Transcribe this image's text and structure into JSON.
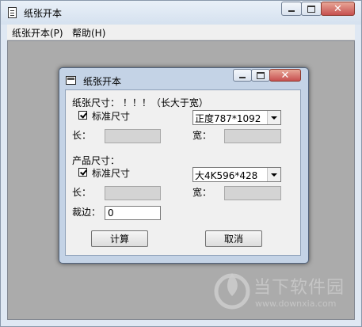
{
  "window": {
    "title": "纸张开本",
    "controls": {
      "minimize": "minimize",
      "maximize": "maximize",
      "close": "✕"
    }
  },
  "menu": [
    {
      "label": "纸张开本(P)"
    },
    {
      "label": "帮助(H)"
    }
  ],
  "dialog": {
    "title": "纸张开本",
    "paper": {
      "heading": "纸张尺寸：  ！！！（长大于宽）",
      "standard_label": "标准尺寸",
      "standard_checked": true,
      "size_select": "正度787*1092",
      "length_label": "长：",
      "width_label": "宽：",
      "length_value": "",
      "width_value": ""
    },
    "product": {
      "heading": "产品尺寸：",
      "standard_label": "标准尺寸",
      "standard_checked": true,
      "size_select": "大4K596*428",
      "length_label": "长：",
      "width_label": "宽：",
      "length_value": "",
      "width_value": ""
    },
    "trim_label": "裁边：",
    "trim_value": "0",
    "calc_button": "计算",
    "cancel_button": "取消"
  },
  "watermark": {
    "main": "当下软件园",
    "sub": "www.downxia.com"
  }
}
